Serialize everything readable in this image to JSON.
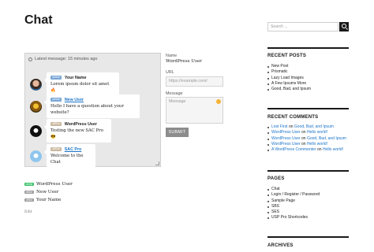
{
  "page_title": "Chat",
  "chat": {
    "header": "Latest message: 15 minutes ago",
    "messages": [
      {
        "badge": "online",
        "name": "Your Name",
        "text": "Lorem ipsum dolor sit amet 🔥"
      },
      {
        "badge": "online",
        "name": "New User",
        "text": "Hello I have a question about your website?"
      },
      {
        "badge": "offline",
        "name": "WordPress User",
        "text": "Testing the new SAC Pro 😎"
      },
      {
        "badge": "offline",
        "name": "SAC Pro",
        "text": "Welcome to the Chat"
      }
    ]
  },
  "form": {
    "name_label": "Name",
    "name_value": "WordPress User",
    "url_label": "URL",
    "url_placeholder": "https://example.com/",
    "message_label": "Message",
    "message_placeholder": "Message",
    "submit_label": "SUBMIT"
  },
  "users": [
    {
      "status": "online",
      "name": "WordPress User"
    },
    {
      "status": "offline",
      "name": "New User"
    },
    {
      "status": "offline",
      "name": "Your Name"
    }
  ],
  "edit_label": "Edit",
  "sidebar": {
    "search_placeholder": "Search ...",
    "recent_posts_title": "RECENT POSTS",
    "recent_posts": [
      "New Post",
      "Prismatic",
      "Lazy Load Images",
      "A Few Ipsums More",
      "Good, Bad, and Ipsum"
    ],
    "recent_comments_title": "RECENT COMMENTS",
    "recent_comments": [
      {
        "author": "Lost First",
        "on": "on",
        "post": "Good, Bad, and Ipsum"
      },
      {
        "author": "WordPress User",
        "on": "on",
        "post": "Hello world!"
      },
      {
        "author": "WordPress User",
        "on": "on",
        "post": "Good, Bad, and Ipsum"
      },
      {
        "author": "WordPress User",
        "on": "on",
        "post": "Hello world!"
      },
      {
        "author": "A WordPress Commenter",
        "on": "on",
        "post": "Hello world!"
      }
    ],
    "pages_title": "PAGES",
    "pages": [
      "Chat",
      "Login / Register / Password",
      "Sample Page",
      "SBS",
      "SES",
      "USP Pro Shortcodes"
    ],
    "archives_title": "ARCHIVES"
  },
  "colors": {
    "online": "#3cc46a",
    "offline": "#9c9c9c",
    "link": "#1a73c8"
  }
}
